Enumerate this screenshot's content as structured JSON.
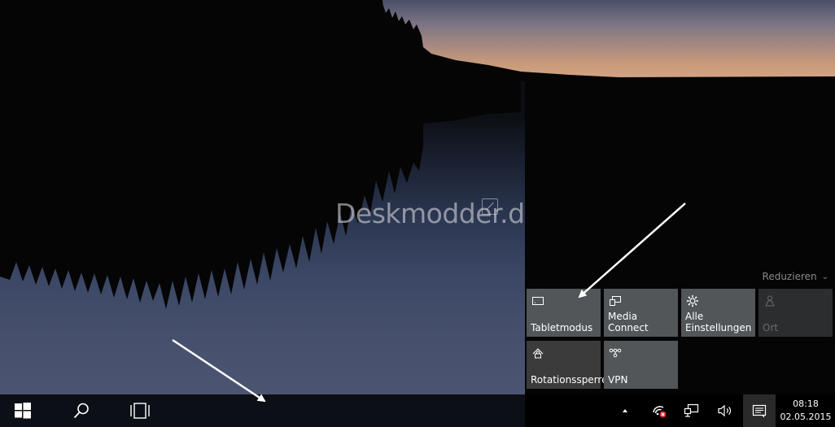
{
  "watermark": {
    "text": "Deskmodder.de"
  },
  "action_center": {
    "reduce_label": "Reduzieren",
    "tiles": [
      {
        "label": "Tabletmodus",
        "icon": "tablet-mode-icon",
        "state": "normal"
      },
      {
        "label": "Media Connect",
        "icon": "media-connect-icon",
        "state": "normal"
      },
      {
        "label": "Alle\nEinstellungen",
        "icon": "gear-icon",
        "state": "normal"
      },
      {
        "label": "Ort",
        "icon": "location-icon",
        "state": "disabled"
      },
      {
        "label": "Rotationssperre",
        "icon": "rotation-lock-icon",
        "state": "dark"
      },
      {
        "label": "VPN",
        "icon": "vpn-icon",
        "state": "normal"
      }
    ]
  },
  "taskbar": {
    "start_icon": "windows-logo-icon",
    "search_icon": "search-icon",
    "task_view_icon": "task-view-icon",
    "tray": {
      "show_hidden_icon": "chevron-up-icon",
      "network_icon": "network-disconnected-icon",
      "pc_network_icon": "ethernet-icon",
      "volume_icon": "speaker-icon",
      "notifications_icon": "action-center-icon"
    },
    "clock": {
      "time": "08:18",
      "date": "02.05.2015"
    }
  },
  "colors": {
    "tile": "#525659",
    "tile_dark": "#3b3b3b",
    "taskbar": "#0c0f16",
    "action_center_bg": "#050505"
  }
}
